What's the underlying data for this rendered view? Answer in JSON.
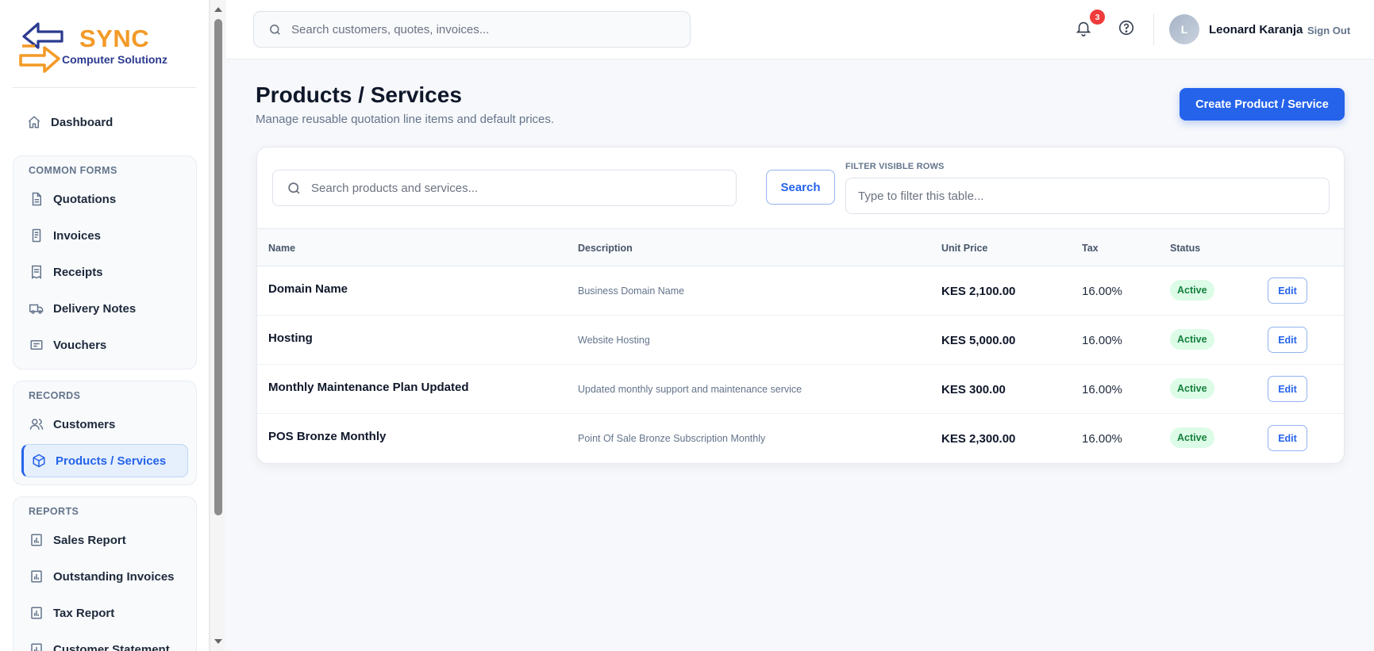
{
  "brand": {
    "name": "SYNC",
    "tagline": "Computer Solutionz",
    "color_primary": "#f39a27",
    "color_secondary": "#2b3a8f"
  },
  "sidebar": {
    "dashboard": {
      "label": "Dashboard",
      "icon": "home-icon"
    },
    "groups": [
      {
        "title": "COMMON FORMS",
        "items": [
          {
            "label": "Quotations",
            "icon": "document-icon"
          },
          {
            "label": "Invoices",
            "icon": "invoice-icon"
          },
          {
            "label": "Receipts",
            "icon": "receipt-icon"
          },
          {
            "label": "Delivery Notes",
            "icon": "truck-icon"
          },
          {
            "label": "Vouchers",
            "icon": "voucher-icon"
          }
        ]
      },
      {
        "title": "RECORDS",
        "items": [
          {
            "label": "Customers",
            "icon": "users-icon"
          },
          {
            "label": "Products / Services",
            "icon": "box-icon",
            "active": true
          }
        ]
      },
      {
        "title": "REPORTS",
        "items": [
          {
            "label": "Sales Report",
            "icon": "report-icon"
          },
          {
            "label": "Outstanding Invoices",
            "icon": "report-icon"
          },
          {
            "label": "Tax Report",
            "icon": "report-icon"
          },
          {
            "label": "Customer Statement",
            "icon": "report-icon"
          }
        ]
      }
    ]
  },
  "topbar": {
    "search_placeholder": "Search customers, quotes, invoices...",
    "notification_count": "3",
    "user": {
      "initial": "L",
      "name": "Leonard Karanja"
    },
    "sign_out_label": "Sign Out"
  },
  "page": {
    "title": "Products / Services",
    "subtitle": "Manage reusable quotation line items and default prices.",
    "create_button_label": "Create Product / Service"
  },
  "toolbar": {
    "search_placeholder": "Search products and services...",
    "search_button_label": "Search",
    "filter_label": "FILTER VISIBLE ROWS",
    "filter_placeholder": "Type to filter this table..."
  },
  "table": {
    "headers": [
      "Name",
      "Description",
      "Unit Price",
      "Tax",
      "Status"
    ],
    "rows": [
      {
        "name": "Domain Name",
        "description": "Business Domain Name",
        "unit_price": "KES 2,100.00",
        "tax": "16.00%",
        "status": "Active",
        "action": "Edit"
      },
      {
        "name": "Hosting",
        "description": "Website Hosting",
        "unit_price": "KES 5,000.00",
        "tax": "16.00%",
        "status": "Active",
        "action": "Edit"
      },
      {
        "name": "Monthly Maintenance Plan Updated",
        "description": "Updated monthly support and maintenance service",
        "unit_price": "KES 300.00",
        "tax": "16.00%",
        "status": "Active",
        "action": "Edit"
      },
      {
        "name": "POS Bronze Monthly",
        "description": "Point Of Sale Bronze Subscription Monthly",
        "unit_price": "KES 2,300.00",
        "tax": "16.00%",
        "status": "Active",
        "action": "Edit"
      }
    ]
  },
  "colors": {
    "accent": "#2563eb",
    "status_active_bg": "#dcfce7",
    "status_active_text": "#15803d",
    "badge": "#ef3b3b"
  }
}
